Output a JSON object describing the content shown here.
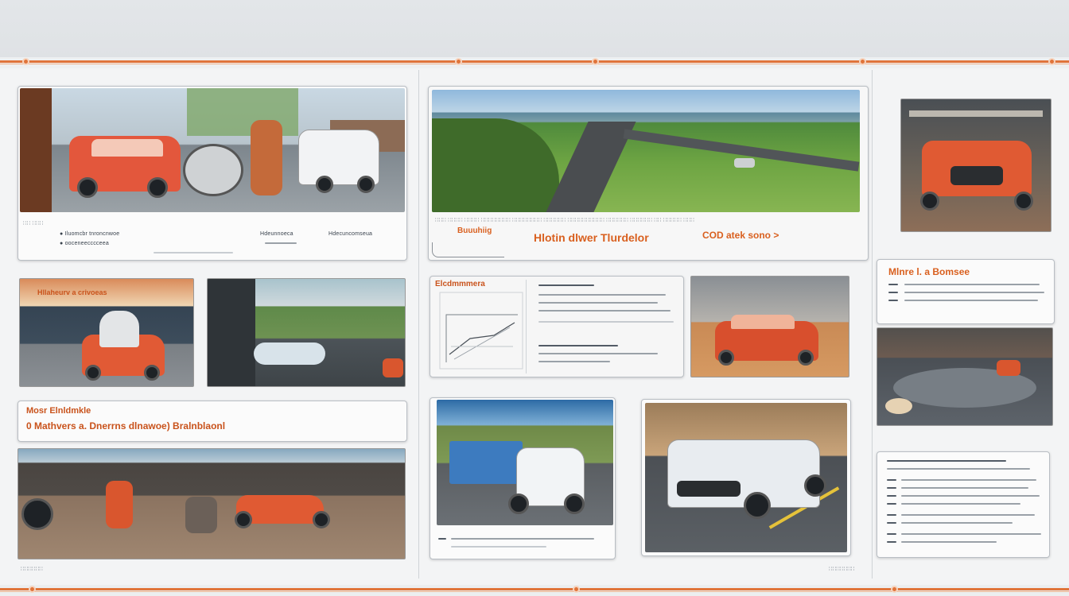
{
  "board": {
    "top_card": {
      "caption_line_1": "● Iluomcbr tnroncnwoe",
      "caption_line_2": "● ooceneecccceea",
      "caption_col_2": "Hdeunnoeca",
      "caption_col_3": "Hdecuncomseua"
    },
    "road_card": {
      "label_left": "Buuuhiig",
      "label_middle": "Hlotin dlwer  Tlurdelor",
      "label_right": "COD  atek  sono >"
    },
    "right_card_1": {
      "title": "Mlnre  l.  a Bomsee"
    },
    "diagram_card": {
      "title": "Elcdmmmera"
    },
    "banner_card": {
      "line_1": "Mosr Elnldmkle",
      "line_2": "0   Mathvers  a.  Dnerrns  dlnawoe)  Bralnblaonl"
    },
    "small_card_title": "Hllaheurv  a  crivoeas"
  }
}
